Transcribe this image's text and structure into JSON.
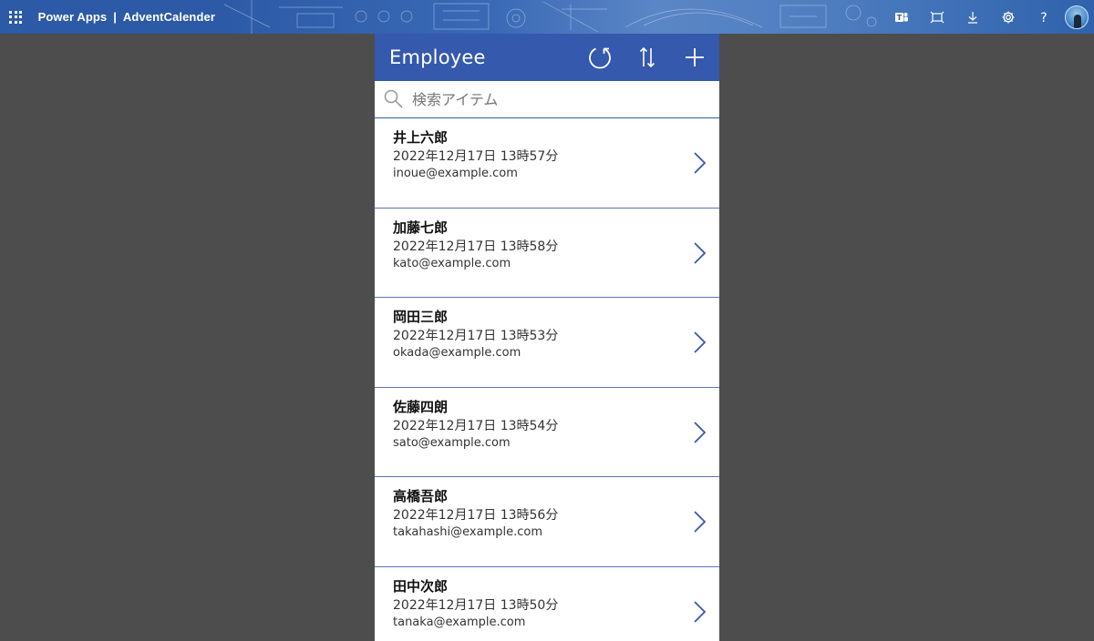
{
  "suitebar": {
    "product": "Power Apps",
    "separator": "|",
    "app_name": "AdventCalender",
    "icons": [
      "waffle-icon",
      "teams-icon",
      "fit-screen-icon",
      "download-icon",
      "settings-icon",
      "help-icon",
      "avatar"
    ]
  },
  "app": {
    "title": "Employee",
    "header_buttons": [
      "refresh-icon",
      "sort-icon",
      "add-icon"
    ],
    "search": {
      "placeholder": "検索アイテム",
      "value": ""
    },
    "colors": {
      "header": "#3559ad",
      "divider": "#5e72b8",
      "background": "#4d4d4d"
    },
    "employees": [
      {
        "name": "井上六郎",
        "datetime": "2022年12月17日 13時57分",
        "email": "inoue@example.com"
      },
      {
        "name": "加藤七郎",
        "datetime": "2022年12月17日 13時58分",
        "email": "kato@example.com"
      },
      {
        "name": "岡田三郎",
        "datetime": "2022年12月17日 13時53分",
        "email": "okada@example.com"
      },
      {
        "name": "佐藤四朗",
        "datetime": "2022年12月17日 13時54分",
        "email": "sato@example.com"
      },
      {
        "name": "高橋吾郎",
        "datetime": "2022年12月17日 13時56分",
        "email": "takahashi@example.com"
      },
      {
        "name": "田中次郎",
        "datetime": "2022年12月17日 13時50分",
        "email": "tanaka@example.com"
      }
    ]
  }
}
